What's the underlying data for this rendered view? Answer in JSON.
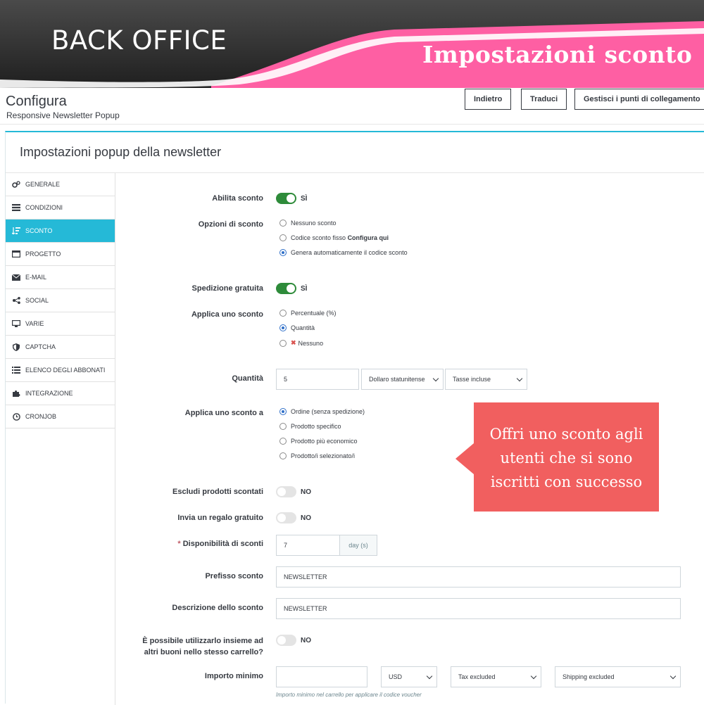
{
  "banner": {
    "left_text": "BACK OFFICE",
    "right_text": "Impostazioni sconto",
    "colors": {
      "dark": "#333333",
      "pink": "#fe5fa3"
    }
  },
  "header": {
    "title": "Configura",
    "subtitle": "Responsive Newsletter Popup",
    "buttons": {
      "back": "Indietro",
      "translate": "Traduci",
      "hooks": "Gestisci i punti di collegamento"
    }
  },
  "panel": {
    "title": "Impostazioni popup della newsletter"
  },
  "sidebar": {
    "items": [
      {
        "label": "GENERALE",
        "icon": "cogs-icon"
      },
      {
        "label": "CONDIZIONI",
        "icon": "list-icon"
      },
      {
        "label": "SCONTO",
        "icon": "sort-amount-icon",
        "active": true
      },
      {
        "label": "PROGETTO",
        "icon": "window-icon"
      },
      {
        "label": "E-MAIL",
        "icon": "envelope-icon"
      },
      {
        "label": "SOCIAL",
        "icon": "share-icon"
      },
      {
        "label": "VARIE",
        "icon": "desktop-icon"
      },
      {
        "label": "CAPTCHA",
        "icon": "shield-icon"
      },
      {
        "label": "ELENCO DEGLI ABBONATI",
        "icon": "list-icon"
      },
      {
        "label": "INTEGRAZIONE",
        "icon": "puzzle-icon"
      },
      {
        "label": "CRONJOB",
        "icon": "clock-icon"
      }
    ]
  },
  "form": {
    "enable_discount": {
      "label": "Abilita sconto",
      "value": "SÌ"
    },
    "discount_options": {
      "label": "Opzioni di sconto",
      "options": [
        "Nessuno sconto",
        "Codice sconto fisso ",
        "Configura qui",
        "Genera automaticamente il codice sconto"
      ],
      "selected": 2
    },
    "free_shipping": {
      "label": "Spedizione gratuita",
      "value": "SÌ"
    },
    "apply_discount": {
      "label": "Applica uno sconto",
      "options": [
        "Percentuale (%)",
        "Quantità",
        "Nessuno"
      ],
      "selected": 1
    },
    "amount": {
      "label": "Quantità",
      "value": "5",
      "currency": "Dollaro statunitense",
      "tax": "Tasse incluse"
    },
    "apply_to": {
      "label": "Applica uno sconto a",
      "options": [
        "Ordine (senza spedizione)",
        "Prodotto specifico",
        "Prodotto più economico",
        "Prodotto/i selezionato/i"
      ],
      "selected": 0
    },
    "exclude_discounted": {
      "label": "Escludi prodotti scontati",
      "value": "NO"
    },
    "free_gift": {
      "label": "Invia un regalo gratuito",
      "value": "NO"
    },
    "availability": {
      "label": "Disponibilità di sconti",
      "value": "7",
      "unit": "day (s)"
    },
    "prefix": {
      "label": "Prefisso sconto",
      "value": "NEWSLETTER"
    },
    "description": {
      "label": "Descrizione dello sconto",
      "value": "NEWSLETTER"
    },
    "combinable": {
      "label_line1": "È possibile utilizzarlo insieme ad",
      "label_line2": "altri buoni nello stesso carrello?",
      "value": "NO"
    },
    "minimum": {
      "label": "Importo minimo",
      "value": "",
      "currency": "USD",
      "tax": "Tax excluded",
      "shipping": "Shipping excluded",
      "hint": "Importo minimo nel carrello per applicare il codice voucher"
    }
  },
  "callout": {
    "lines": [
      "Offri uno sconto agli",
      "utenti che si sono",
      "iscritti con successo"
    ],
    "color": "#f15f5f"
  },
  "colors": {
    "accent": "#25b9d7",
    "toggle_on": "#2e8b3a"
  }
}
